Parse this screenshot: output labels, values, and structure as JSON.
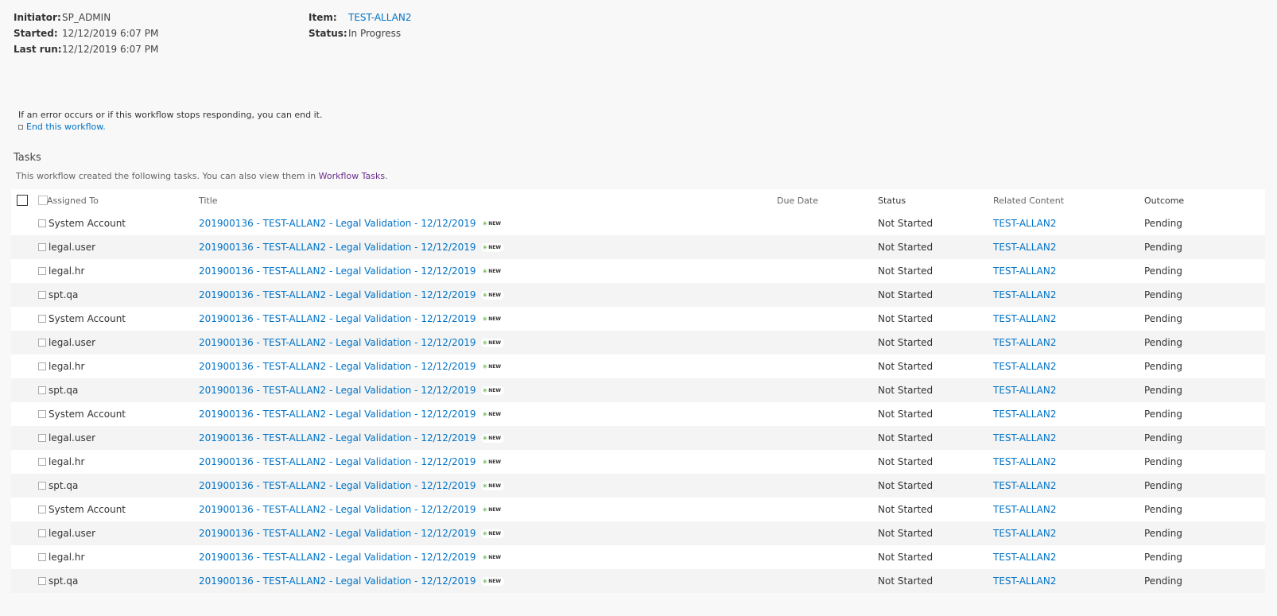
{
  "workflow_info": {
    "initiator_label": "Initiator:",
    "initiator": "SP_ADMIN",
    "started_label": "Started:",
    "started": "12/12/2019 6:07 PM",
    "last_run_label": "Last run:",
    "last_run": "12/12/2019 6:07 PM",
    "item_label": "Item:",
    "item": "TEST-ALLAN2",
    "status_label": "Status:",
    "status": "In Progress"
  },
  "error_message": "If an error occurs or if this workflow stops responding, you can end it.",
  "end_workflow_link": "End this workflow.",
  "tasks": {
    "heading": "Tasks",
    "description_prefix": "This workflow created the following tasks. You can also view them in ",
    "workflow_tasks_link": "Workflow Tasks",
    "description_suffix": ".",
    "columns": [
      "Assigned To",
      "Title",
      "Due Date",
      "Status",
      "Related Content",
      "Outcome"
    ],
    "new_badge": "NEW",
    "rows": [
      {
        "assigned_to": "System Account",
        "title": "201900136 -  TEST-ALLAN2 - Legal Validation - 12/12/2019",
        "due_date": "",
        "status": "Not Started",
        "related_content": "TEST-ALLAN2",
        "outcome": "Pending"
      },
      {
        "assigned_to": "legal.user",
        "title": "201900136 -  TEST-ALLAN2 - Legal Validation - 12/12/2019",
        "due_date": "",
        "status": "Not Started",
        "related_content": "TEST-ALLAN2",
        "outcome": "Pending"
      },
      {
        "assigned_to": "legal.hr",
        "title": "201900136 -  TEST-ALLAN2 - Legal Validation - 12/12/2019",
        "due_date": "",
        "status": "Not Started",
        "related_content": "TEST-ALLAN2",
        "outcome": "Pending"
      },
      {
        "assigned_to": "spt.qa",
        "title": "201900136 -  TEST-ALLAN2 - Legal Validation - 12/12/2019",
        "due_date": "",
        "status": "Not Started",
        "related_content": "TEST-ALLAN2",
        "outcome": "Pending"
      },
      {
        "assigned_to": "System Account",
        "title": "201900136 -  TEST-ALLAN2 - Legal Validation - 12/12/2019",
        "due_date": "",
        "status": "Not Started",
        "related_content": "TEST-ALLAN2",
        "outcome": "Pending"
      },
      {
        "assigned_to": "legal.user",
        "title": "201900136 -  TEST-ALLAN2 - Legal Validation - 12/12/2019",
        "due_date": "",
        "status": "Not Started",
        "related_content": "TEST-ALLAN2",
        "outcome": "Pending"
      },
      {
        "assigned_to": "legal.hr",
        "title": "201900136 -  TEST-ALLAN2 - Legal Validation - 12/12/2019",
        "due_date": "",
        "status": "Not Started",
        "related_content": "TEST-ALLAN2",
        "outcome": "Pending"
      },
      {
        "assigned_to": "spt.qa",
        "title": "201900136 -  TEST-ALLAN2 - Legal Validation - 12/12/2019",
        "due_date": "",
        "status": "Not Started",
        "related_content": "TEST-ALLAN2",
        "outcome": "Pending"
      },
      {
        "assigned_to": "System Account",
        "title": "201900136 -  TEST-ALLAN2 - Legal Validation - 12/12/2019",
        "due_date": "",
        "status": "Not Started",
        "related_content": "TEST-ALLAN2",
        "outcome": "Pending"
      },
      {
        "assigned_to": "legal.user",
        "title": "201900136 -  TEST-ALLAN2 - Legal Validation - 12/12/2019",
        "due_date": "",
        "status": "Not Started",
        "related_content": "TEST-ALLAN2",
        "outcome": "Pending"
      },
      {
        "assigned_to": "legal.hr",
        "title": "201900136 -  TEST-ALLAN2 - Legal Validation - 12/12/2019",
        "due_date": "",
        "status": "Not Started",
        "related_content": "TEST-ALLAN2",
        "outcome": "Pending"
      },
      {
        "assigned_to": "spt.qa",
        "title": "201900136 -  TEST-ALLAN2 - Legal Validation - 12/12/2019",
        "due_date": "",
        "status": "Not Started",
        "related_content": "TEST-ALLAN2",
        "outcome": "Pending"
      },
      {
        "assigned_to": "System Account",
        "title": "201900136 -  TEST-ALLAN2 - Legal Validation - 12/12/2019",
        "due_date": "",
        "status": "Not Started",
        "related_content": "TEST-ALLAN2",
        "outcome": "Pending"
      },
      {
        "assigned_to": "legal.user",
        "title": "201900136 -  TEST-ALLAN2 - Legal Validation - 12/12/2019",
        "due_date": "",
        "status": "Not Started",
        "related_content": "TEST-ALLAN2",
        "outcome": "Pending"
      },
      {
        "assigned_to": "legal.hr",
        "title": "201900136 -  TEST-ALLAN2 - Legal Validation - 12/12/2019",
        "due_date": "",
        "status": "Not Started",
        "related_content": "TEST-ALLAN2",
        "outcome": "Pending"
      },
      {
        "assigned_to": "spt.qa",
        "title": "201900136 -  TEST-ALLAN2 - Legal Validation - 12/12/2019",
        "due_date": "",
        "status": "Not Started",
        "related_content": "TEST-ALLAN2",
        "outcome": "Pending"
      }
    ]
  },
  "colors": {
    "link": "#0072c6",
    "visited_link": "#6b2f8f",
    "new_icon": "#4a9e2f",
    "background": "#f8f8f8"
  }
}
